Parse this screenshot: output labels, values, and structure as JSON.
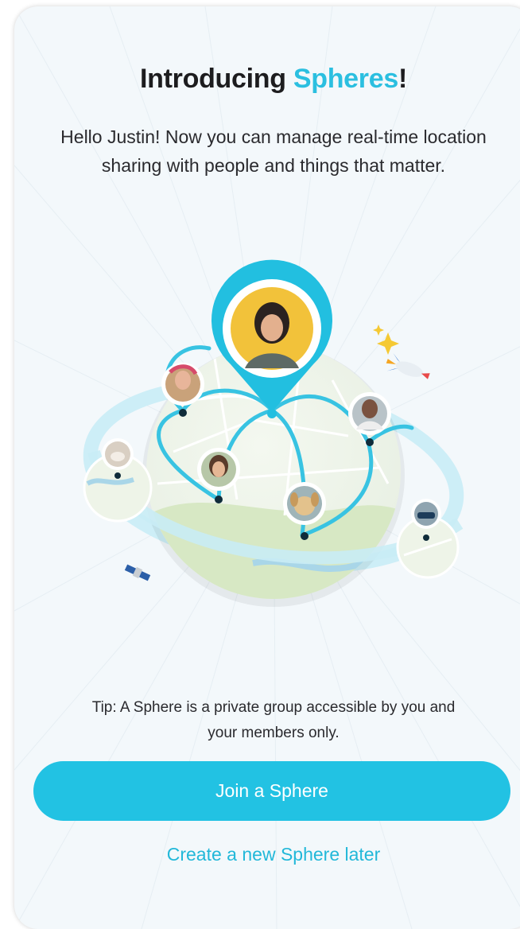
{
  "header": {
    "title_prefix": "Introducing ",
    "title_accent": "Spheres",
    "title_suffix": "!",
    "subtitle": "Hello Justin! Now you can manage real-time location sharing with people and things that matter."
  },
  "illustration": {
    "members": [
      "woman-avatar",
      "person-avatar-1",
      "person-avatar-2",
      "person-avatar-3",
      "pet-avatar-1",
      "dog-avatar",
      "car-avatar"
    ],
    "decorations": [
      "sparkles-icon",
      "rocket-icon",
      "satellite-icon"
    ]
  },
  "tip": "Tip: A Sphere is a private group accessible by you and your members only.",
  "actions": {
    "join_label": "Join a Sphere",
    "later_label": "Create a new Sphere later"
  },
  "colors": {
    "accent": "#2bbfe0",
    "button": "#22c2e3",
    "background": "#f3f8fb",
    "map_green": "#dcecc9"
  }
}
